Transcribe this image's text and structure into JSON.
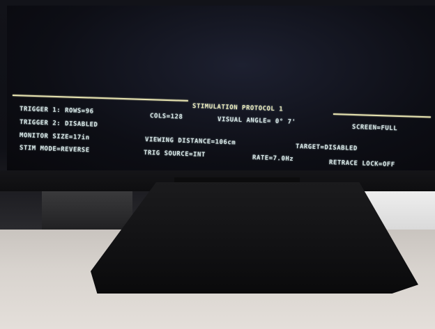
{
  "protocol_display": {
    "title": "STIMULATION PROTOCOL 1",
    "trigger1": "TRIGGER 1: ROWS=96",
    "cols": "COLS=128",
    "visual_angle": "VISUAL ANGLE= 0° 7'",
    "screen": "SCREEN=FULL",
    "trigger2": "TRIGGER 2: DISABLED",
    "monitor_size": "MONITOR SIZE=17in",
    "viewing_distance": "VIEWING DISTANCE=106cm",
    "target": "TARGET=DISABLED",
    "stim_mode": "STIM MODE=REVERSE",
    "trig_source": "TRIG SOURCE=INT",
    "rate": "RATE=7.0Hz",
    "retrace_lock": "RETRACE LOCK=OFF"
  },
  "colors": {
    "text": "#d8e6e6",
    "rule": "#e6e2b0",
    "screen_bg": "#0d0e15"
  }
}
